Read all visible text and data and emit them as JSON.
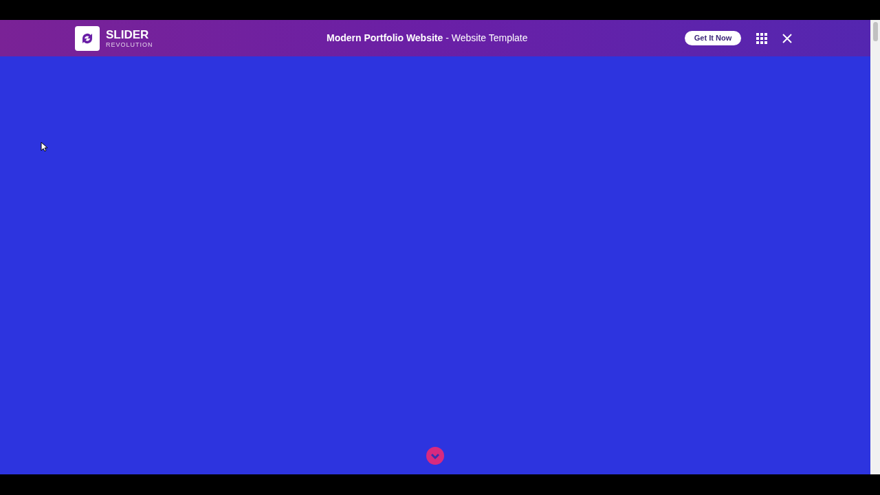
{
  "header": {
    "logo": {
      "name": "SLIDER",
      "subtitle": "REVOLUTION"
    },
    "title": "**Modern Portfolio Website** - Website Template",
    "cta": "Get It Now"
  }
}
